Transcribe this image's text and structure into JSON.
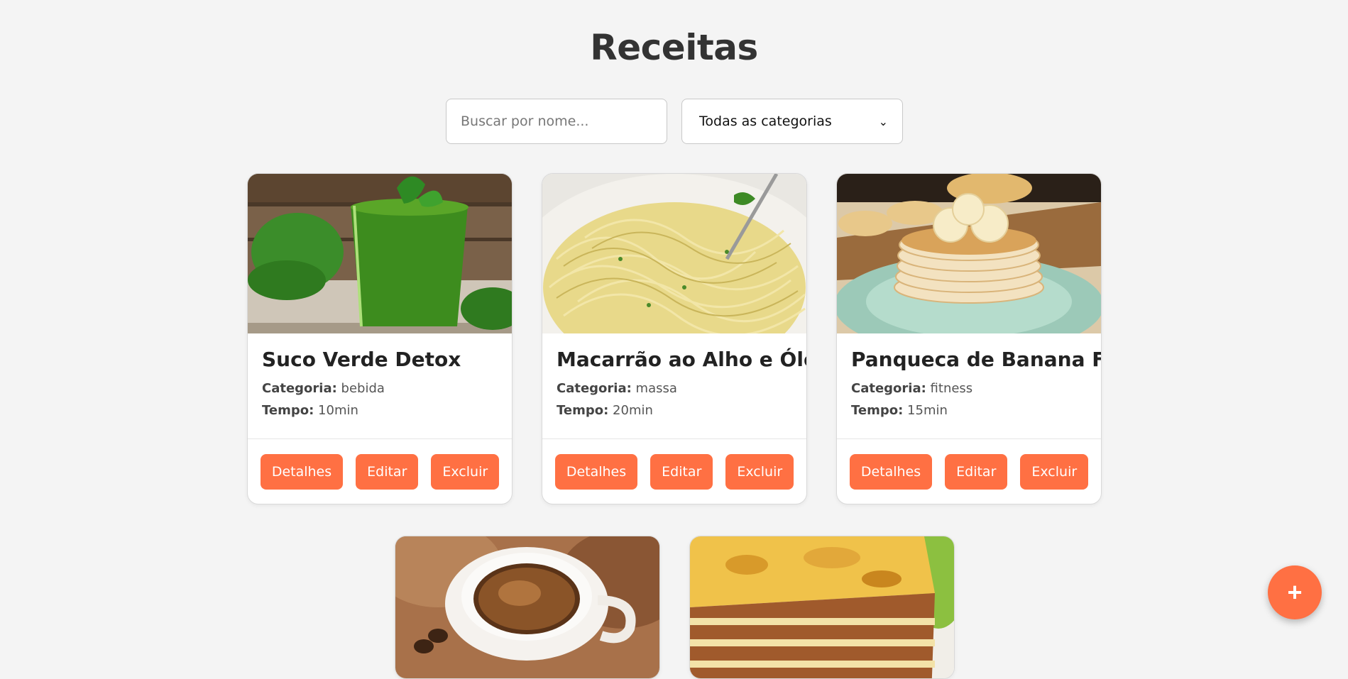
{
  "header": {
    "title": "Receitas"
  },
  "filters": {
    "search_placeholder": "Buscar por nome...",
    "category_selected": "Todas as categorias"
  },
  "labels": {
    "category": "Categoria:",
    "time": "Tempo:"
  },
  "recipes": [
    {
      "name": "Suco Verde Detox",
      "category": "bebida",
      "time": "10min",
      "image": "green-smoothie-photo"
    },
    {
      "name": "Macarrão ao Alho e Óleo",
      "category": "massa",
      "time": "20min",
      "image": "spaghetti-photo"
    },
    {
      "name": "Panqueca de Banana Fit",
      "category": "fitness",
      "time": "15min",
      "image": "banana-pancakes-photo"
    },
    {
      "image": "espresso-coffee-photo"
    },
    {
      "image": "lasagna-photo"
    }
  ],
  "actions": {
    "details": "Detalhes",
    "edit": "Editar",
    "delete": "Excluir"
  },
  "fab": {
    "label": "+"
  },
  "colors": {
    "accent": "#ff7043",
    "background": "#f4f4f4"
  }
}
